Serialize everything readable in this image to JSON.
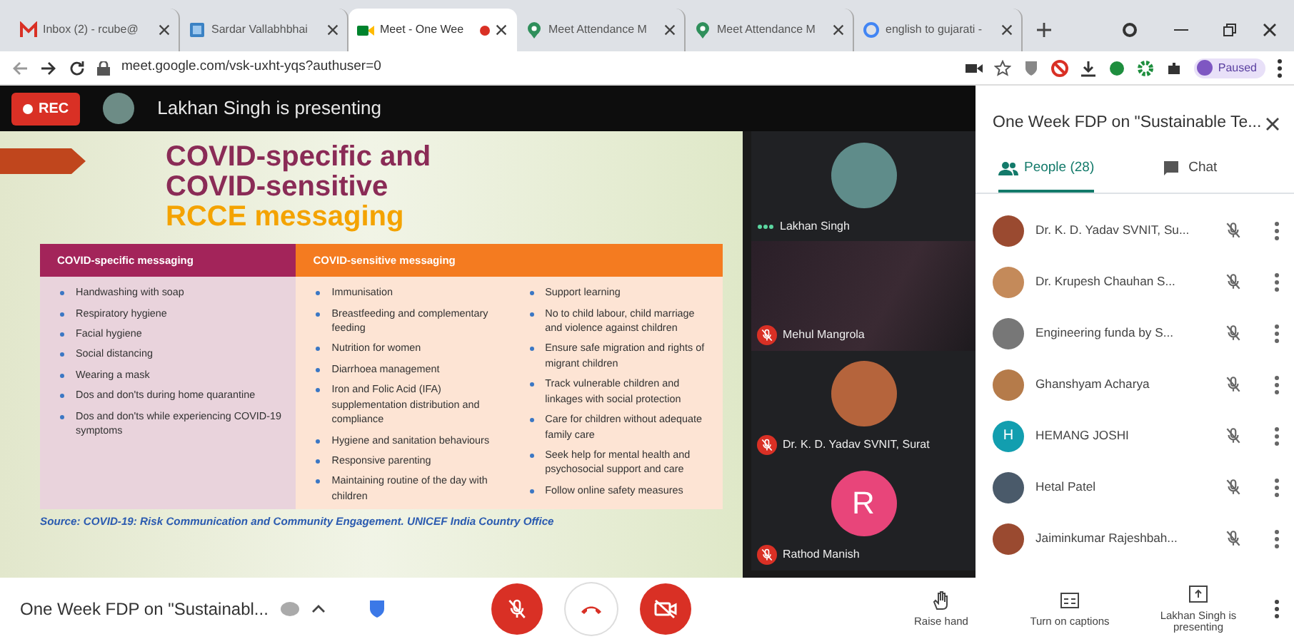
{
  "browser": {
    "tabs": [
      {
        "title": "Inbox (2) - rcube@",
        "selected": false,
        "recording": false
      },
      {
        "title": "Sardar Vallabhbhai",
        "selected": false,
        "recording": false
      },
      {
        "title": "Meet - One Wee",
        "selected": true,
        "recording": true
      },
      {
        "title": "Meet Attendance M",
        "selected": false,
        "recording": false
      },
      {
        "title": "Meet Attendance M",
        "selected": false,
        "recording": false
      },
      {
        "title": "english to gujarati -",
        "selected": false,
        "recording": false
      }
    ],
    "address": "meet.google.com/vsk-uxht-yqs?authuser=0",
    "profile_label": "Paused"
  },
  "stage": {
    "rec_label": "REC",
    "presenter_banner": "Lakhan Singh is presenting",
    "slide": {
      "title_lines": [
        "COVID-specific and",
        "COVID-sensitive"
      ],
      "highlight": "RCCE messaging",
      "columns": [
        {
          "heading": "COVID-specific messaging",
          "lists": [
            [
              "Handwashing with soap",
              "Respiratory hygiene",
              "Facial hygiene",
              "Social distancing",
              "Wearing a mask",
              "Dos and don'ts during home quarantine",
              "Dos and don'ts while experiencing COVID-19 symptoms"
            ]
          ]
        },
        {
          "heading": "COVID-sensitive messaging",
          "lists": [
            [
              "Immunisation",
              "Breastfeeding and complementary feeding",
              "Nutrition for women",
              "Diarrhoea management",
              "Iron and Folic Acid (IFA) supplementation distribution and compliance",
              "Hygiene and sanitation behaviours",
              "Responsive parenting",
              "Maintaining routine of the day with children"
            ],
            [
              "Support learning",
              "No to child labour, child marriage and violence against children",
              "Ensure safe migration and rights of migrant children",
              "Track vulnerable children and linkages with social protection",
              "Care for children without adequate family care",
              "Seek help for mental health and psychosocial support and care",
              "Follow online safety measures"
            ]
          ]
        }
      ],
      "source": "Source: COVID-19: Risk Communication and Community Engagement. UNICEF India Country Office"
    },
    "tiles": [
      {
        "name": "Lakhan Singh",
        "kind": "photo",
        "muted": false,
        "talking": true
      },
      {
        "name": "Mehul Mangrola",
        "kind": "video",
        "muted": true,
        "talking": false
      },
      {
        "name": "Dr. K. D. Yadav SVNIT, Surat",
        "kind": "photo",
        "muted": true,
        "talking": false
      },
      {
        "name": "Rathod Manish",
        "kind": "letter",
        "letter": "R",
        "color": "#e8457a",
        "muted": true,
        "talking": false
      }
    ]
  },
  "panel": {
    "title": "One Week FDP on \"Sustainable Te...",
    "tabs": [
      {
        "label": "People (28)",
        "selected": true
      },
      {
        "label": "Chat",
        "selected": false
      }
    ],
    "participants": [
      {
        "name": "Dr. K. D. Yadav SVNIT, Su...",
        "kind": "photo",
        "muted": true
      },
      {
        "name": "Dr. Krupesh Chauhan S...",
        "kind": "photo",
        "muted": true
      },
      {
        "name": "Engineering funda by S...",
        "kind": "photo",
        "muted": true
      },
      {
        "name": "Ghanshyam Acharya",
        "kind": "photo",
        "muted": true
      },
      {
        "name": "HEMANG JOSHI",
        "kind": "letter",
        "letter": "H",
        "color": "#129eaf",
        "muted": true
      },
      {
        "name": "Hetal Patel",
        "kind": "photo",
        "muted": true
      },
      {
        "name": "Jaiminkumar Rajeshbah...",
        "kind": "photo",
        "muted": true
      }
    ]
  },
  "bottom_bar": {
    "meeting_title": "One Week FDP on \"Sustainabl...",
    "mic_muted": true,
    "camera_off": true,
    "actions": [
      {
        "label": "Raise hand"
      },
      {
        "label": "Turn on captions"
      },
      {
        "label": "Lakhan Singh is presenting"
      }
    ]
  }
}
